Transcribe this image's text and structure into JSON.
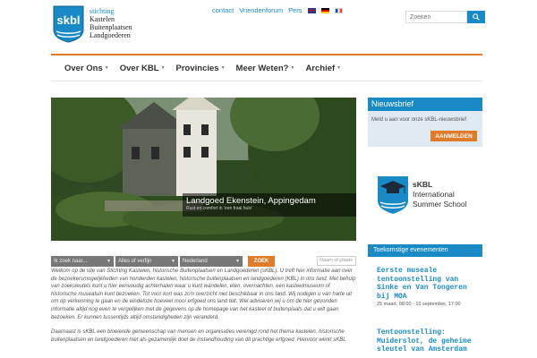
{
  "header": {
    "logo": {
      "abbr": "skbl",
      "line1": "stichting",
      "line2": "Kastelen",
      "line3": "Buitenplaatsen",
      "line4": "Landgoederen"
    },
    "top_links": [
      "contact",
      "Vriendenforum",
      "Pers"
    ],
    "search": {
      "placeholder": "Zoeken",
      "icon": "search-icon"
    }
  },
  "nav": {
    "items": [
      {
        "label": "Over Ons"
      },
      {
        "label": "Over KBL"
      },
      {
        "label": "Provincies"
      },
      {
        "label": "Meer Weten?"
      },
      {
        "label": "Archief"
      }
    ]
  },
  "hero": {
    "title": "Landgoed Ekenstein, Appingedam",
    "subtitle": "Rust en comfort in 'een fraai huis'"
  },
  "filters": {
    "select1": "Ik zoek naar...",
    "select2": "Alles of verfijn",
    "select3": "Nederland",
    "button": "ZOEK",
    "place_placeholder": "Naam of plaats"
  },
  "intro": {
    "p1": "Welkom op de site van Stichting Kastelen, historische Buitenplaatsen en Landgoederen (sKBL). U treft hier informatie aan over de bezoekersmogelijkheden van honderden kastelen, historische buitenplaatsen en landgoederen (KBL) in ons land. Met behulp van zoeksleutels kunt u hier eenvoudig achterhalen waar u kunt wandelen, eten, overnachten, een kasteelmuseum of historische museatuin kunt bezoeken. Tot voor kort was zo'n overzicht niet beschikbaar in ons land. Wij nodigen u van harte uit om op verkenning te gaan en de eindeloze hoeveel mooi erfgoed ons land telt. Wel adviseren wij u om de hier gevonden informatie altijd nog even te vergelijken met de gegevens op de homepage van het kasteel of buitenplaats dat u wilt gaan bezoeken. Er kunnen tussentijds altijd omstandigheden zijn veranderd.",
    "p2": "Daarnaast is sKBL een bloeiende gemeenschap van mensen en organisaties verenigd rond het thema kastelen, historische buitenplaatsen en landgoederen met als gezamenlijk doel de instandhouding van dit prachtige erfgoed. Hiervoor werkt sKBL"
  },
  "newsletter": {
    "title": "Nieuwsbrief",
    "text": "Meld u aan voor onze sKBL-nieuwsbrief",
    "button": "AANMELDEN"
  },
  "summer_school": {
    "line1": "sKBL",
    "line2": "International",
    "line3": "Summer School"
  },
  "events": {
    "title": "Toekomstige evenementen",
    "items": [
      {
        "title": "Eerste museale tentoonstelling van Sinke en Van Tongeren bij MOA",
        "date": "25 maart, 08:00 - 10 september, 17:00"
      },
      {
        "title": "Tentoonstelling: Muiderslot, de geheime sleutel van Amsterdam",
        "date": ""
      }
    ]
  },
  "colors": {
    "accent_blue": "#1a8ac6",
    "accent_orange": "#e07b2a"
  }
}
